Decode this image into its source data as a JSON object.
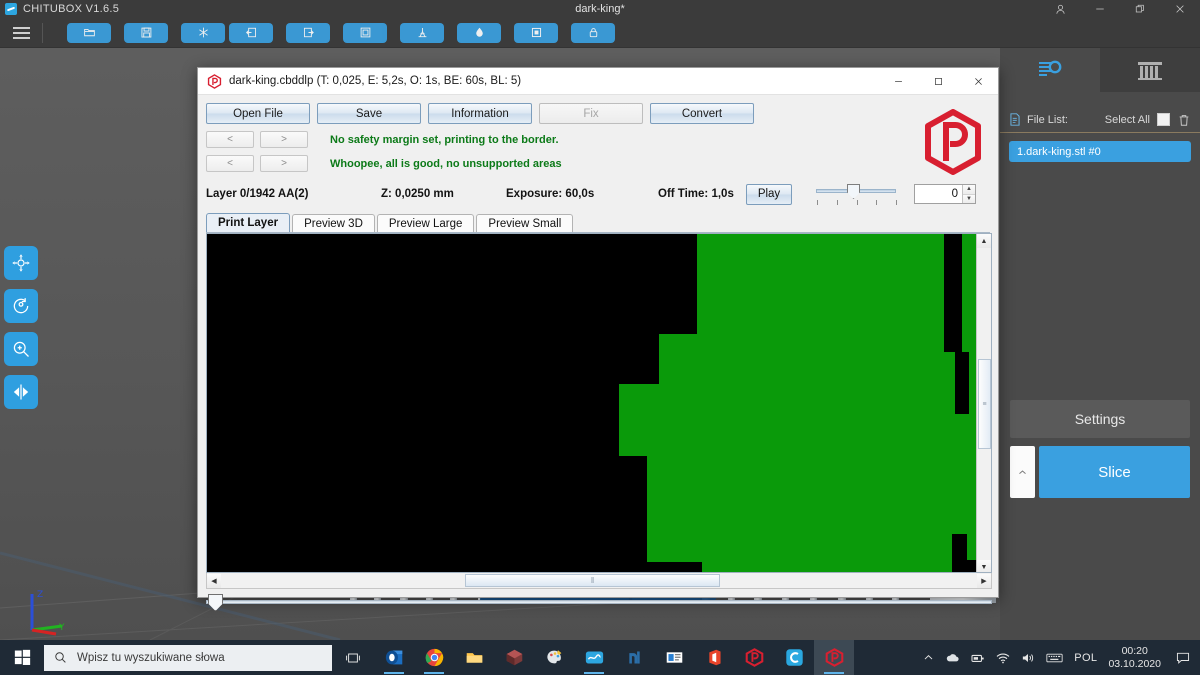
{
  "app": {
    "title": "CHITUBOX V1.6.5",
    "document_title": "dark-king*",
    "logo_icon": "chitubox-logo-icon",
    "account_icon": "account-icon",
    "minimize_icon": "minimize-icon",
    "restore_icon": "restore-icon",
    "close_icon": "close-icon",
    "menu_icon": "hamburger-menu-icon"
  },
  "toolbar": {
    "buttons": [
      {
        "name": "open-file-button",
        "icon": "folder-open-icon"
      },
      {
        "name": "save-button",
        "icon": "save-disk-icon"
      },
      {
        "name": "add-model-button",
        "icon": "snowflake-model-icon"
      },
      {
        "name": "import-button",
        "icon": "import-arrow-icon"
      },
      {
        "name": "export-button",
        "icon": "export-arrow-icon"
      },
      {
        "name": "copy-button",
        "icon": "duplicate-icon"
      },
      {
        "name": "supports-button",
        "icon": "supports-icon"
      },
      {
        "name": "hollow-button",
        "icon": "droplet-hollow-icon"
      },
      {
        "name": "dig-hole-button",
        "icon": "square-hole-icon"
      },
      {
        "name": "lock-button",
        "icon": "lock-icon"
      }
    ]
  },
  "tool_rail": {
    "buttons": [
      {
        "name": "move-tool",
        "icon": "move-arrows-icon"
      },
      {
        "name": "rotate-tool",
        "icon": "rotate-icon"
      },
      {
        "name": "scale-tool",
        "icon": "scale-magnifier-icon"
      },
      {
        "name": "mirror-tool",
        "icon": "mirror-icon"
      }
    ]
  },
  "viewport": {
    "axis_gizmo": {
      "z_label": "Z",
      "y_label": "Y",
      "x_label": ""
    }
  },
  "right_panel": {
    "tabs": [
      {
        "name": "tab-slice-settings",
        "icon": "settings-list-gear-icon",
        "active": true
      },
      {
        "name": "tab-machine",
        "icon": "printer-machine-icon",
        "active": false
      }
    ],
    "file_list_label": "File List:",
    "file_list_icon": "document-icon",
    "select_all_label": "Select All",
    "delete_icon": "trash-icon",
    "files": [
      {
        "label": "1.dark-king.stl #0",
        "selected": true
      }
    ],
    "settings_label": "Settings",
    "slice_label": "Slice",
    "slice_expand_icon": "chevron-up-icon"
  },
  "dialog": {
    "icon": "photon-file-validator-icon",
    "title": "dark-king.cbddlp (T: 0,025, E: 5,2s, O: 1s, BE: 60s, BL: 5)",
    "minimize_icon": "minimize-icon",
    "maximize_icon": "maximize-icon",
    "close_icon": "close-icon",
    "buttons": [
      {
        "label": "Open File",
        "name": "open-file-button",
        "disabled": false
      },
      {
        "label": "Save",
        "name": "save-button",
        "disabled": false
      },
      {
        "label": "Information",
        "name": "information-button",
        "disabled": false
      },
      {
        "label": "Fix",
        "name": "fix-button",
        "disabled": true
      },
      {
        "label": "Convert",
        "name": "convert-button",
        "disabled": false
      }
    ],
    "nav_rows": [
      {
        "prev": "<",
        "next": ">",
        "message": "No safety margin set, printing to the border."
      },
      {
        "prev": "<",
        "next": ">",
        "message": "Whoopee, all is good, no unsupported areas"
      }
    ],
    "status": {
      "layer": "Layer 0/1942 AA(2)",
      "z": "Z: 0,0250 mm",
      "exposure": "Exposure: 60,0s",
      "off_time": "Off Time: 1,0s",
      "play_label": "Play",
      "slider_value_percent": 42,
      "spin_value": "0",
      "spin_up_icon": "spin-up-icon",
      "spin_down_icon": "spin-down-icon"
    },
    "tabs": [
      {
        "label": "Print Layer",
        "active": true
      },
      {
        "label": "Preview 3D",
        "active": false
      },
      {
        "label": "Preview Large",
        "active": false
      },
      {
        "label": "Preview Small",
        "active": false
      }
    ],
    "preview": {
      "background_color": "#000000",
      "layer_color": "#0a9a0a",
      "description": "Layer 0 cross-section, large solid green region on the right two-thirds"
    },
    "scroll": {
      "v_up_icon": "scroll-up-icon",
      "v_down_icon": "scroll-down-icon",
      "h_left_icon": "scroll-left-icon",
      "h_right_icon": "scroll-right-icon"
    }
  },
  "taskbar": {
    "start_icon": "windows-start-icon",
    "search_icon": "search-icon",
    "search_placeholder": "Wpisz tu wyszukiwane słowa",
    "task_view_icon": "task-view-icon",
    "apps": [
      {
        "name": "outlook-taskbar-icon",
        "running": true
      },
      {
        "name": "chrome-taskbar-icon",
        "running": true
      },
      {
        "name": "file-explorer-taskbar-icon",
        "running": false
      },
      {
        "name": "3d-viewer-taskbar-icon",
        "running": false
      },
      {
        "name": "paint3d-taskbar-icon",
        "running": false
      },
      {
        "name": "chitubox-taskbar-icon",
        "running": true
      },
      {
        "name": "nanodlp-taskbar-icon",
        "running": false
      },
      {
        "name": "media-taskbar-icon",
        "running": false
      },
      {
        "name": "office-taskbar-icon",
        "running": false
      },
      {
        "name": "photon-taskbar-icon",
        "running": false
      },
      {
        "name": "cura-taskbar-icon",
        "running": false
      },
      {
        "name": "photon-validator-taskbar-icon",
        "running": true,
        "active": true
      }
    ],
    "tray": {
      "chevron_icon": "show-hidden-icons-icon",
      "onedrive_icon": "onedrive-icon",
      "device_icon": "removable-device-icon",
      "wifi_icon": "wifi-icon",
      "volume_icon": "volume-icon",
      "keyboard_icon": "keyboard-icon",
      "language": "POL",
      "time": "00:20",
      "date": "03.10.2020",
      "notification_icon": "notification-icon"
    }
  },
  "colors": {
    "accent_blue": "#3aa0e0",
    "panel_dark": "#4a4a4a",
    "titlebar_dark": "#3b3b3b",
    "status_green": "#0c7a18",
    "layer_green": "#0a9a0a",
    "taskbar": "#1f2a36"
  }
}
